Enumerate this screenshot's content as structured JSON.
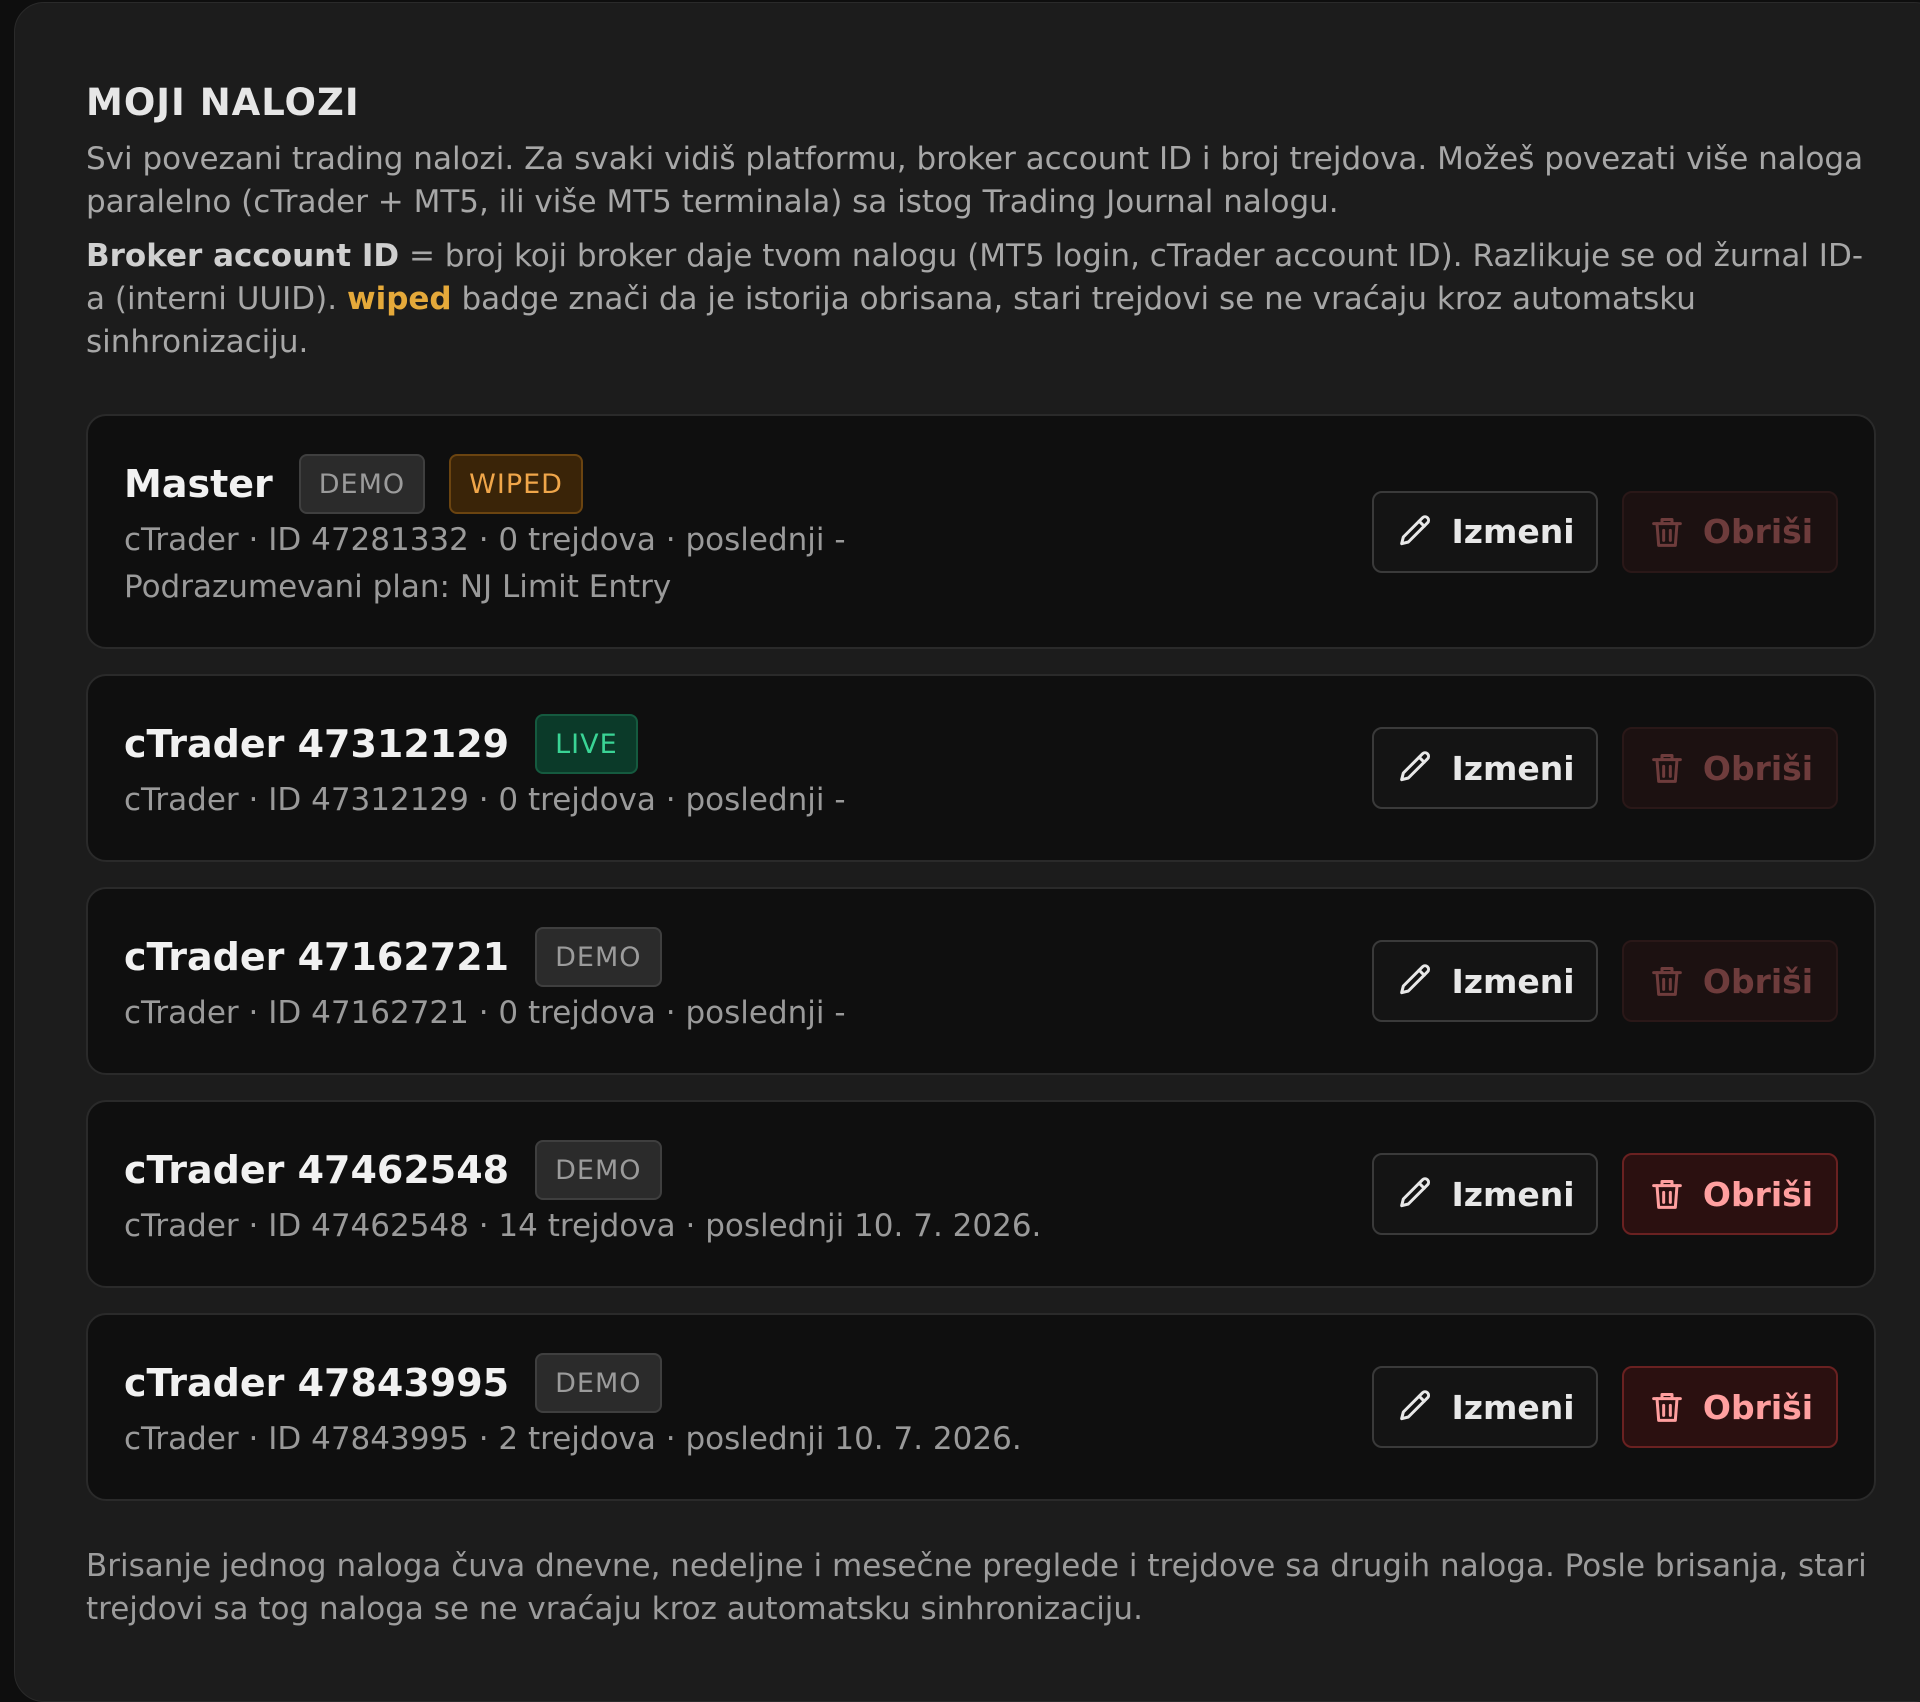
{
  "section": {
    "title": "MOJI NALOZI",
    "intro": "Svi povezani trading nalozi. Za svaki vidiš platformu, broker account ID i broj trejdova. Možeš povezati više naloga paralelno (cTrader + MT5, ili više MT5 terminala) sa istog Trading Journal nalogu.",
    "note_strong": "Broker account ID",
    "note_part1": " = broj koji broker daje tvom nalogu (MT5 login, cTrader account ID). Razlikuje se od žurnal ID-a (interni UUID). ",
    "note_wiped": "wiped",
    "note_part2": " badge znači da je istorija obrisana, stari trejdovi se ne vraćaju kroz automatsku sinhronizaciju."
  },
  "buttons": {
    "edit": "Izmeni",
    "delete": "Obriši"
  },
  "accounts": [
    {
      "name": "Master",
      "badges": [
        {
          "label": "DEMO",
          "kind": "demo"
        },
        {
          "label": "WIPED",
          "kind": "wiped"
        }
      ],
      "meta": "cTrader · ID 47281332 · 0 trejdova · poslednji -",
      "meta2": "Podrazumevani plan: NJ Limit Entry",
      "delete_enabled": false
    },
    {
      "name": "cTrader 47312129",
      "badges": [
        {
          "label": "LIVE",
          "kind": "live"
        }
      ],
      "meta": "cTrader · ID 47312129 · 0 trejdova · poslednji -",
      "meta2": "",
      "delete_enabled": false
    },
    {
      "name": "cTrader 47162721",
      "badges": [
        {
          "label": "DEMO",
          "kind": "demo"
        }
      ],
      "meta": "cTrader · ID 47162721 · 0 trejdova · poslednji -",
      "meta2": "",
      "delete_enabled": false
    },
    {
      "name": "cTrader 47462548",
      "badges": [
        {
          "label": "DEMO",
          "kind": "demo"
        }
      ],
      "meta": "cTrader · ID 47462548 · 14 trejdova · poslednji 10. 7. 2026.",
      "meta2": "",
      "delete_enabled": true
    },
    {
      "name": "cTrader 47843995",
      "badges": [
        {
          "label": "DEMO",
          "kind": "demo"
        }
      ],
      "meta": "cTrader · ID 47843995 · 2 trejdova · poslednji 10. 7. 2026.",
      "meta2": "",
      "delete_enabled": true
    }
  ],
  "footer_note": "Brisanje jednog naloga čuva dnevne, nedeljne i mesečne preglede i trejdove sa drugih naloga. Posle brisanja, stari trejdovi sa tog naloga se ne vraćaju kroz automatsku sinhronizaciju.",
  "colors": {
    "background": "#1c1c1c",
    "card": "#0f0f0f",
    "wiped_accent": "#e5a93a",
    "live_accent": "#3ad495",
    "delete_accent": "#ff9f9f"
  },
  "icons": {
    "edit": "pencil-icon",
    "delete": "trash-icon"
  }
}
